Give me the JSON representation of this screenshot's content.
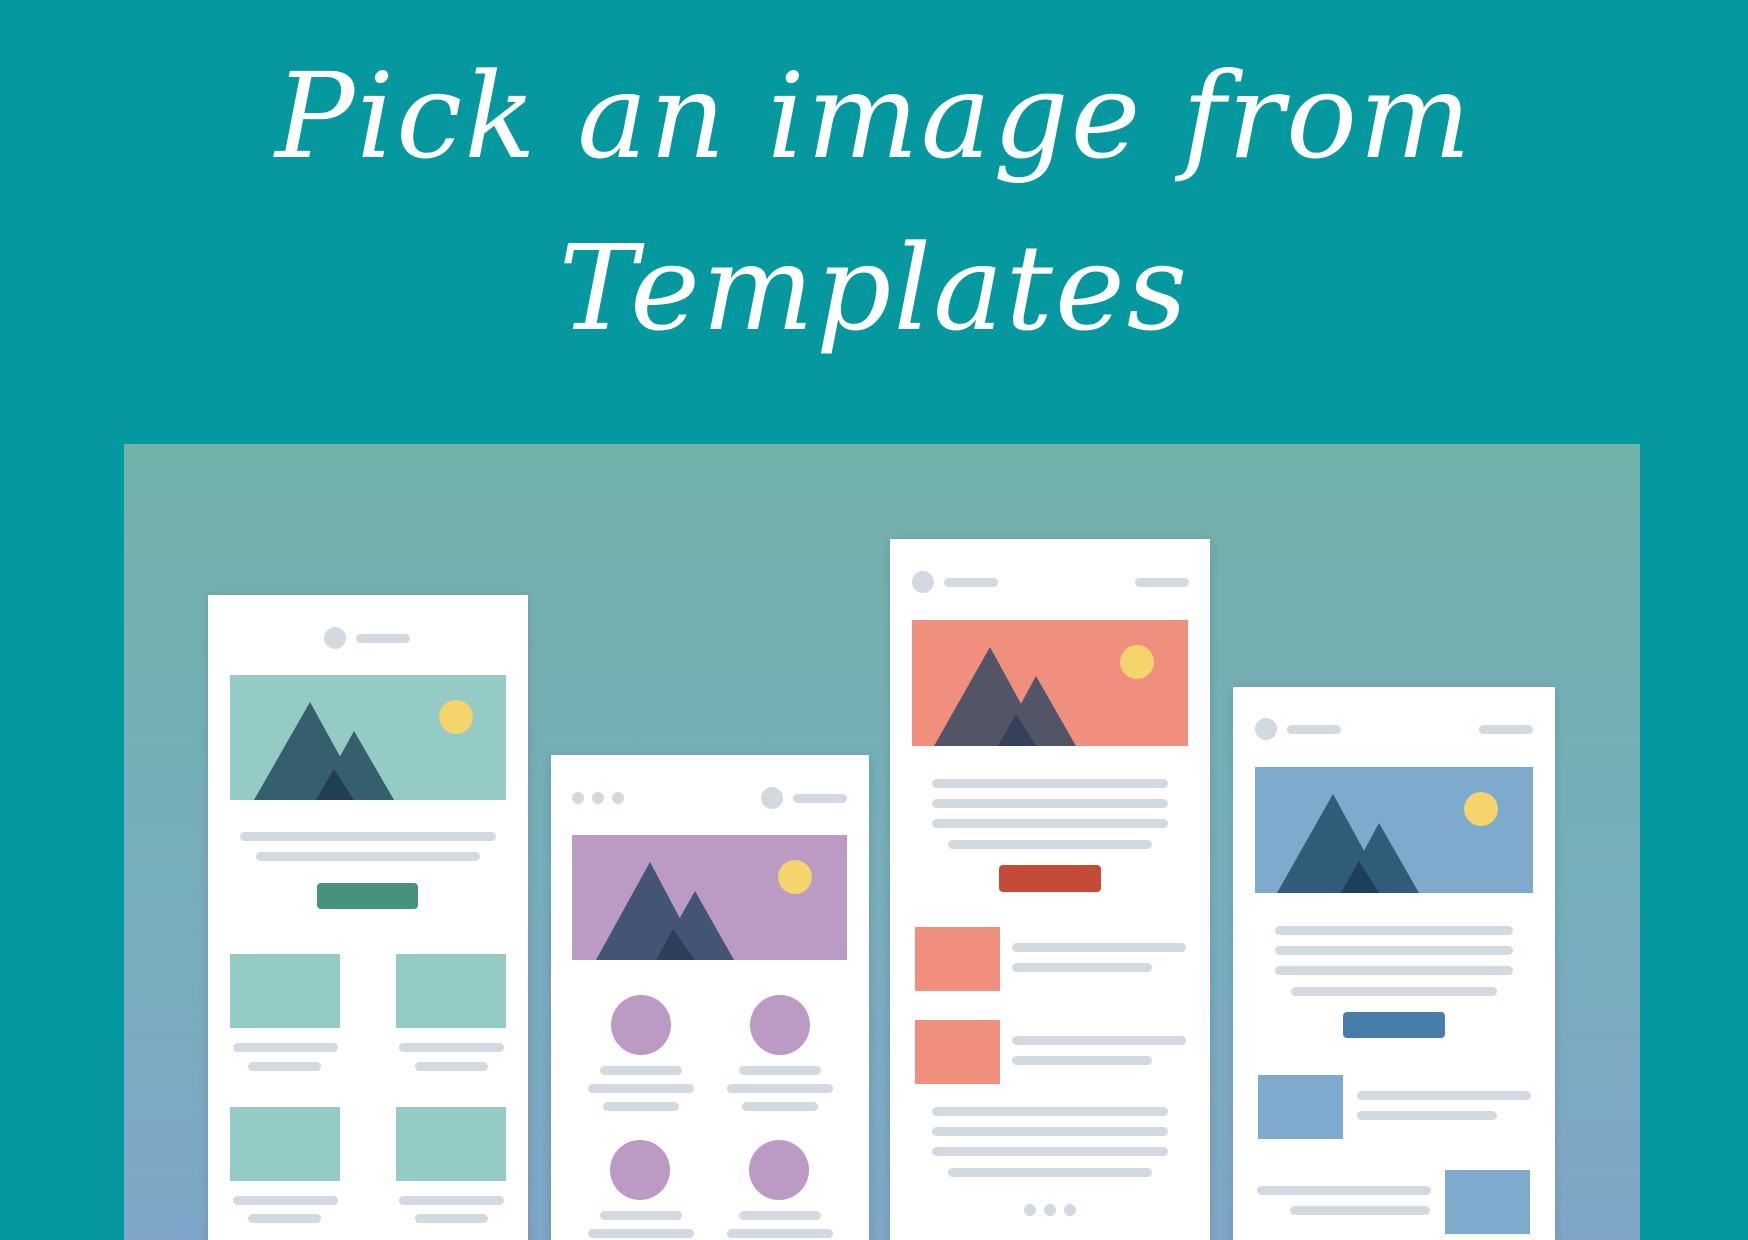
{
  "headline": {
    "line1": "Pick an image from",
    "line2": "Templates"
  },
  "colors": {
    "background": "#05989e",
    "card": "#ffffff",
    "placeholder_line": "#d3d9e0",
    "sun": "#f4d46b",
    "template_1_accent": "#94cbc4",
    "template_1_button": "#45927f",
    "template_2_accent": "#bb9ac4",
    "template_3_accent": "#f18f7e",
    "template_3_button": "#c44c37",
    "template_4_accent": "#7eaacd",
    "template_4_button": "#467ea9"
  },
  "templates": [
    {
      "name": "template-1",
      "accent": "teal"
    },
    {
      "name": "template-2",
      "accent": "purple"
    },
    {
      "name": "template-3",
      "accent": "coral"
    },
    {
      "name": "template-4",
      "accent": "blue"
    }
  ]
}
